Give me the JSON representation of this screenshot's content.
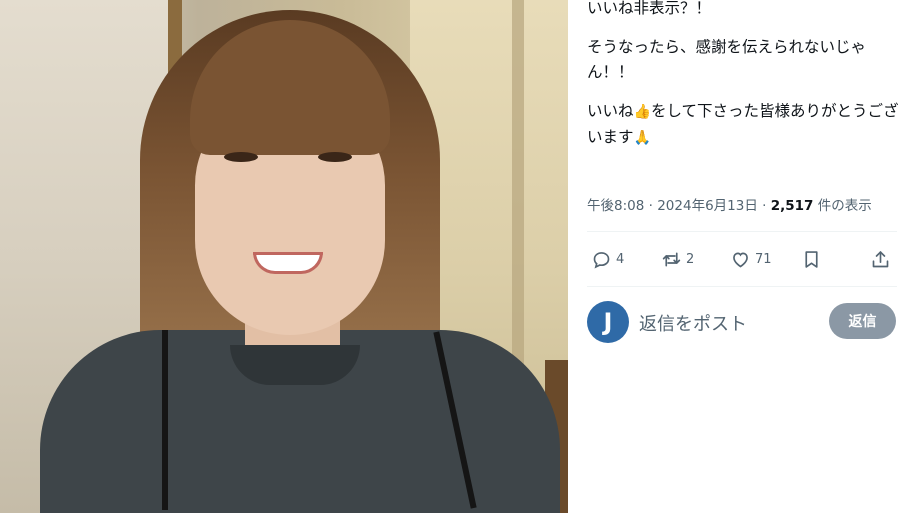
{
  "photo": {
    "alt_icon": "person-photo"
  },
  "tweet": {
    "lines": [
      "いいね非表示？！",
      "そうなったら、感謝を伝えられないじゃん！！",
      "いいね"
    ],
    "line3_rest": "をして下さった皆様ありがとうございます",
    "emoji_thumbs": "👍",
    "emoji_pray": "🙏",
    "time": "午後8:08",
    "sep": "·",
    "date": "2024年6月13日",
    "views": "2,517",
    "views_label": "件の表示"
  },
  "actions": {
    "reply_count": "4",
    "retweet_count": "2",
    "like_count": "71"
  },
  "reply": {
    "avatar_letter": "J",
    "placeholder": "返信をポスト",
    "button": "返信"
  },
  "colors": {
    "text": "#0f1419",
    "muted": "#536471",
    "divider": "#eff3f4",
    "avatar": "#2f6aa7",
    "reply_button": "#8b98a5"
  }
}
